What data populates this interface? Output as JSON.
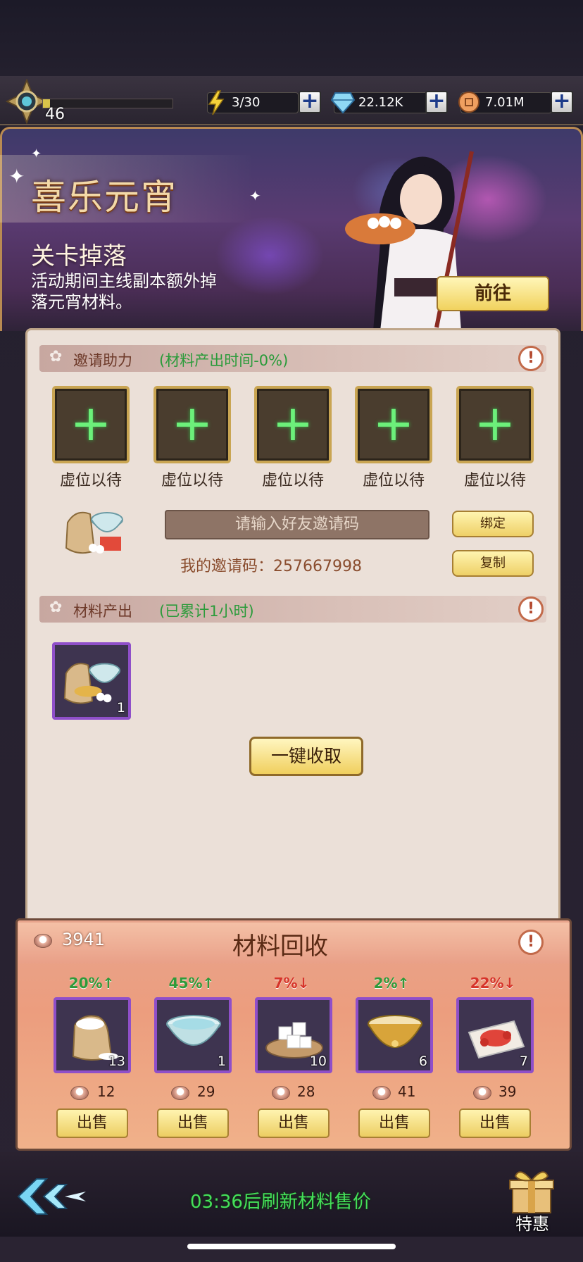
{
  "hud": {
    "level": "46",
    "energy": "3/30",
    "gems": "22.12K",
    "gold": "7.01M"
  },
  "banner": {
    "title": "喜乐元宵",
    "subtitle": "关卡掉落",
    "description": "活动期间主线副本额外掉落元宵材料。",
    "go_label": "前往"
  },
  "invite": {
    "title": "邀请助力",
    "bonus": "(材料产出时间-0%)",
    "slots": [
      "虚位以待",
      "虚位以待",
      "虚位以待",
      "虚位以待",
      "虚位以待"
    ],
    "input_placeholder": "请输入好友邀请码",
    "bind_label": "绑定",
    "copy_label": "复制",
    "my_code": "我的邀请码：257667998"
  },
  "output": {
    "title": "材料产出",
    "accumulated": "(已累计1小时)",
    "items": [
      {
        "icon": "material-bundle-icon",
        "count": "1"
      }
    ],
    "collect_label": "一键收取"
  },
  "recycle": {
    "title": "材料回收",
    "currency": "3941",
    "items": [
      {
        "icon": "flour-sack-icon",
        "pct": "20%↑",
        "trend": "up",
        "count": "13",
        "price": "12",
        "sell": "出售"
      },
      {
        "icon": "water-bowl-icon",
        "pct": "45%↑",
        "trend": "up",
        "count": "1",
        "price": "29",
        "sell": "出售"
      },
      {
        "icon": "sugar-cubes-icon",
        "pct": "7%↓",
        "trend": "down",
        "count": "10",
        "price": "28",
        "sell": "出售"
      },
      {
        "icon": "filling-bowl-icon",
        "pct": "2%↑",
        "trend": "up",
        "count": "6",
        "price": "41",
        "sell": "出售"
      },
      {
        "icon": "rose-petals-icon",
        "pct": "22%↓",
        "trend": "down",
        "count": "7",
        "price": "39",
        "sell": "出售"
      }
    ]
  },
  "footer": {
    "refresh_timer": "03:36后刷新材料售价",
    "special_offer": "特惠"
  },
  "colors": {
    "accent_green": "#2a9b3a",
    "down_red": "#d6342a",
    "button_gold": "#f0cf5e",
    "rare_purple": "#8f4fc9"
  }
}
